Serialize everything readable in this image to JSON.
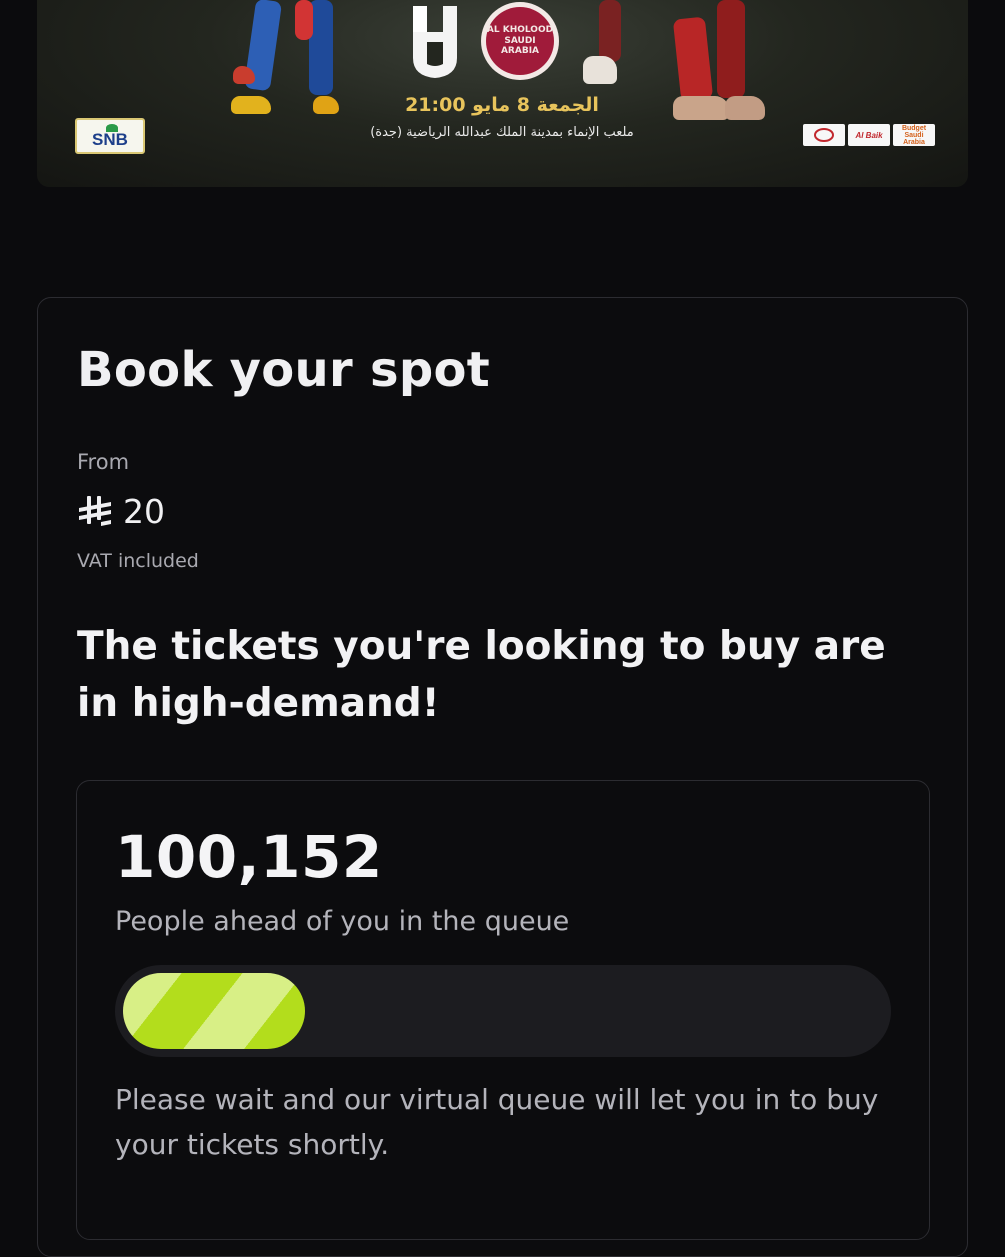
{
  "banner": {
    "match_time": "الجمعة 8 مايو 21:00",
    "venue": "ملعب الإنماء بمدينة الملك عبدالله الرياضية (جدة)",
    "home_logo": "al-hilal-logo",
    "away_logo_text": "AL KHOLOOD SAUDI ARABIA",
    "bank_sponsor": "SNB",
    "sponsors": [
      "",
      "Al Baik",
      "Budget Saudi Arabia"
    ]
  },
  "booking": {
    "title": "Book your spot",
    "from_label": "From",
    "currency_icon": "saudi-riyal-icon",
    "price": "20",
    "vat_label": "VAT included",
    "demand_heading": "The tickets you're looking to buy are in high-demand!"
  },
  "queue": {
    "ahead_count": "100,152",
    "ahead_label": "People ahead of you in the queue",
    "progress_fraction": 0.24,
    "note": "Please wait and our virtual queue will let you in to buy your tickets shortly.",
    "accent_color": "#b3dd1c"
  }
}
